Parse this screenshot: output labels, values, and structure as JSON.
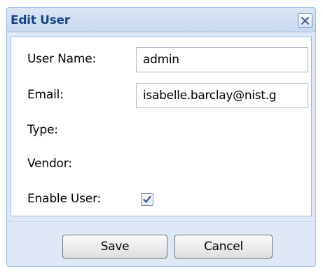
{
  "dialog": {
    "title": "Edit User",
    "close_icon": "close-icon"
  },
  "form": {
    "user_name_label": "User Name:",
    "user_name_value": "admin",
    "email_label": "Email:",
    "email_value": "isabelle.barclay@nist.g",
    "type_label": "Type:",
    "vendor_label": "Vendor:",
    "enable_user_label": "Enable User:",
    "enable_user_checked": true
  },
  "buttons": {
    "save_label": "Save",
    "cancel_label": "Cancel"
  },
  "colors": {
    "title_text": "#15428b",
    "frame_background": "#dfe8f6",
    "frame_border": "#99bbe8"
  }
}
